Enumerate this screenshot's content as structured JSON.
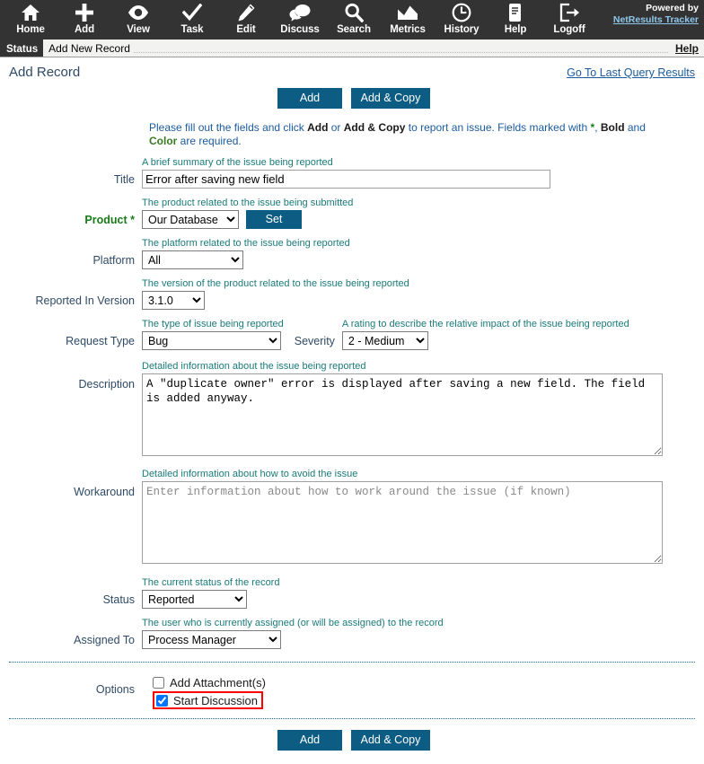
{
  "nav": {
    "items": [
      {
        "label": "Home",
        "icon": "home-icon"
      },
      {
        "label": "Add",
        "icon": "plus-icon"
      },
      {
        "label": "View",
        "icon": "eye-icon"
      },
      {
        "label": "Task",
        "icon": "checkmark-icon"
      },
      {
        "label": "Edit",
        "icon": "pencil-icon"
      },
      {
        "label": "Discuss",
        "icon": "speech-bubbles-icon"
      },
      {
        "label": "Search",
        "icon": "magnifier-icon"
      },
      {
        "label": "Metrics",
        "icon": "chart-icon"
      },
      {
        "label": "History",
        "icon": "clock-icon"
      },
      {
        "label": "Help",
        "icon": "document-icon"
      },
      {
        "label": "Logoff",
        "icon": "exit-icon"
      }
    ],
    "powered_by": "Powered by",
    "brand_link": "NetResults Tracker"
  },
  "status": {
    "tab_label": "Status",
    "message": "Add New Record",
    "help_label": "Help"
  },
  "header": {
    "title": "Add Record",
    "last_query_link": "Go To Last Query Results"
  },
  "toolbar": {
    "add_label": "Add",
    "add_copy_label": "Add & Copy"
  },
  "intro": {
    "part1": "Please fill out the fields and click ",
    "add": "Add",
    "part2": " or ",
    "add_copy": "Add & Copy",
    "part3": " to report an issue. Fields marked with ",
    "star": "*",
    "part4": ", ",
    "bold": "Bold",
    "part5": " and ",
    "color": "Color",
    "part6": " are required."
  },
  "fields": {
    "title": {
      "label": "Title",
      "hint": "A brief summary of the issue being reported",
      "value": "Error after saving new field"
    },
    "product": {
      "label": "Product",
      "required_marker": "*",
      "hint": "The product related to the issue being submitted",
      "value": "Our Database",
      "options": [
        "Our Database"
      ],
      "set_button": "Set"
    },
    "platform": {
      "label": "Platform",
      "hint": "The platform related to the issue being reported",
      "value": "All",
      "options": [
        "All"
      ]
    },
    "version": {
      "label": "Reported In Version",
      "hint": "The version of the product related to the issue being reported",
      "value": "3.1.0",
      "options": [
        "3.1.0"
      ]
    },
    "request_type": {
      "label": "Request Type",
      "hint": "The type of issue being reported",
      "value": "Bug",
      "options": [
        "Bug"
      ]
    },
    "severity": {
      "label": "Severity",
      "hint": "A rating to describe the relative impact of the issue being reported",
      "value": "2 - Medium",
      "options": [
        "2 - Medium"
      ]
    },
    "description": {
      "label": "Description",
      "hint": "Detailed information about the issue being reported",
      "value": "A \"duplicate owner\" error is displayed after saving a new field. The field is added anyway."
    },
    "workaround": {
      "label": "Workaround",
      "hint": "Detailed information about how to avoid the issue",
      "value": "",
      "placeholder": "Enter information about how to work around the issue (if known)"
    },
    "status": {
      "label": "Status",
      "hint": "The current status of the record",
      "value": "Reported",
      "options": [
        "Reported"
      ]
    },
    "assigned_to": {
      "label": "Assigned To",
      "hint": "The user who is currently assigned (or will be assigned) to the record",
      "value": "Process Manager",
      "options": [
        "Process Manager"
      ]
    },
    "options": {
      "label": "Options",
      "add_attachment_label": "Add Attachment(s)",
      "add_attachment_checked": false,
      "start_discussion_label": "Start Discussion",
      "start_discussion_checked": true
    }
  },
  "colors": {
    "nav_background": "#333333",
    "button_blue": "#0d5c84",
    "hint_teal": "#1a7a7a",
    "label_slate": "#2e4a66",
    "link_blue": "#1a5a9e",
    "required_green": "#1a7a1a",
    "highlight_red": "#ff0000"
  }
}
